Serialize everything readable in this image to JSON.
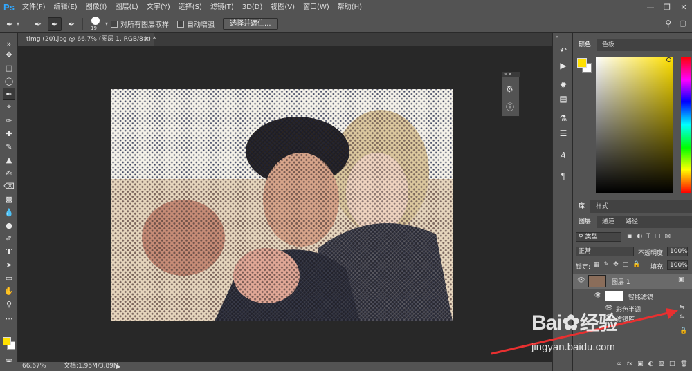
{
  "app": {
    "logo": "Ps"
  },
  "menu": [
    "文件(F)",
    "编辑(E)",
    "图像(I)",
    "图层(L)",
    "文字(Y)",
    "选择(S)",
    "滤镜(T)",
    "3D(D)",
    "视图(V)",
    "窗口(W)",
    "帮助(H)"
  ],
  "options": {
    "brush_size": "19",
    "sample_all_layers": "对所有图层取样",
    "auto_enhance": "自动增强",
    "select_and_mask": "选择并遮住..."
  },
  "document": {
    "tab_title": "timg (20).jpg @ 66.7% (图层 1, RGB/8#) *"
  },
  "status": {
    "zoom": "66.67%",
    "doc_size": "文档:1.95M/3.89M"
  },
  "panels": {
    "color_tabs": [
      "颜色",
      "色板"
    ],
    "library_tabs": [
      "库",
      "样式"
    ],
    "layer_tabs": [
      "图层",
      "通道",
      "路径"
    ],
    "filter_kind": "类型",
    "blend_mode": "正常",
    "opacity_label": "不透明度:",
    "opacity_value": "100%",
    "lock_label": "锁定:",
    "fill_label": "填充:",
    "fill_value": "100%",
    "layers": [
      {
        "name": "图层 1"
      },
      {
        "name": "智能滤镜"
      },
      {
        "name": "彩色半调"
      },
      {
        "name": "滤镜库"
      }
    ],
    "colors": {
      "foreground": "#ffe000",
      "background": "#ffffff"
    }
  },
  "watermark": {
    "brand": "Bai",
    "brand2": "经验",
    "url": "jingyan.baidu.com"
  }
}
